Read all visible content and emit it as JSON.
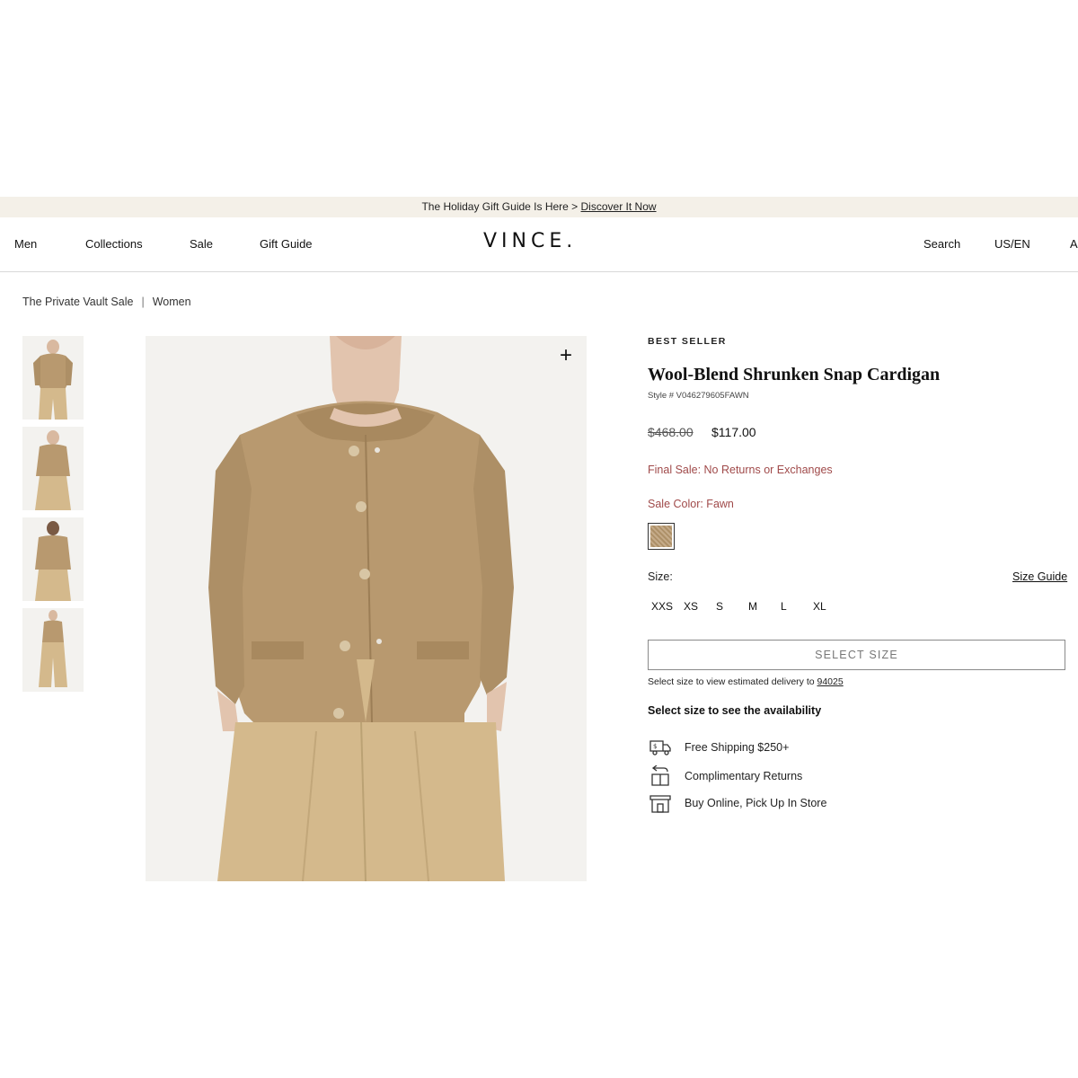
{
  "promo": {
    "text": "The Holiday Gift Guide Is Here > ",
    "link": "Discover It Now"
  },
  "nav": {
    "items": [
      "Men",
      "Collections",
      "Sale",
      "Gift Guide"
    ],
    "logo": "VINCE.",
    "right": [
      "Search",
      "US/EN",
      "A"
    ]
  },
  "breadcrumb": {
    "items": [
      "The Private Vault Sale",
      "Women"
    ],
    "separator": "|"
  },
  "gallery": {
    "thumbnail_count": 4,
    "zoom_icon": "plus-icon",
    "zoom_glyph": "+"
  },
  "product": {
    "badge": "BEST SELLER",
    "title": "Wool-Blend Shrunken Snap Cardigan",
    "style": "Style # V046279605FAWN",
    "price_original": "$468.00",
    "price_sale": "$117.00",
    "final_sale": "Final Sale: No Returns or Exchanges",
    "sale_color": "Sale Color: Fawn",
    "swatch_color": "#b8996f",
    "size_label": "Size:",
    "size_guide": "Size Guide",
    "sizes": [
      "XXS",
      "XS",
      "S",
      "M",
      "L",
      "XL"
    ],
    "select_button": "SELECT SIZE",
    "delivery_text": "Select size to view estimated delivery to ",
    "zip": "94025",
    "availability": "Select size to see the availability"
  },
  "perks": [
    {
      "icon": "shipping-icon",
      "label": "Free Shipping $250+"
    },
    {
      "icon": "returns-icon",
      "label": "Complimentary Returns"
    },
    {
      "icon": "store-icon",
      "label": "Buy Online, Pick Up In Store"
    }
  ],
  "colors": {
    "accent_red": "#a04a4a",
    "promo_bg": "#f4f0e8",
    "sweater": "#b8996f",
    "pants": "#d4b98c"
  }
}
